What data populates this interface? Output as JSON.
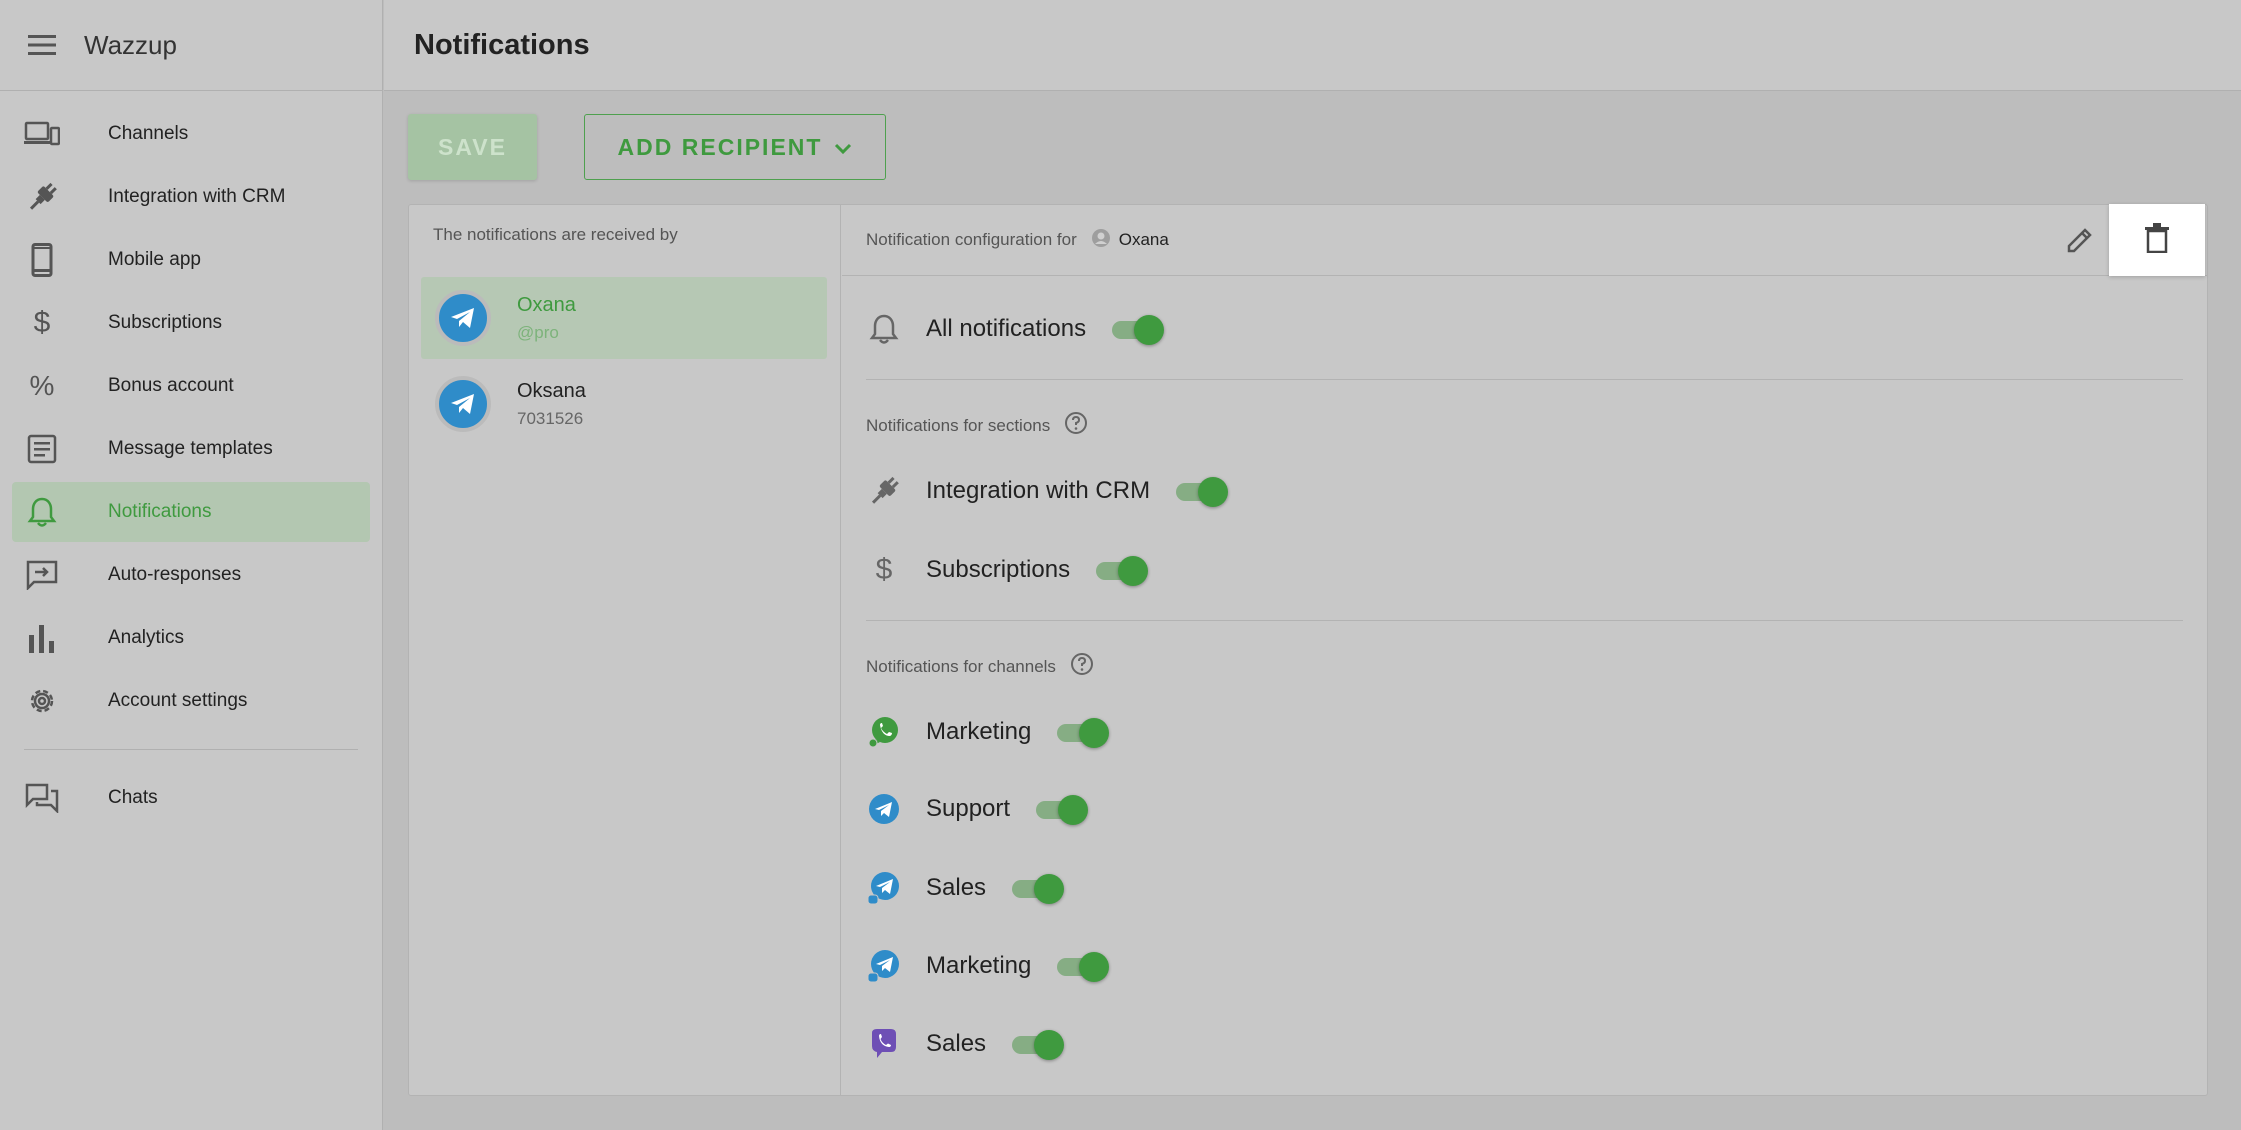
{
  "app": {
    "brand": "Wazzup"
  },
  "header": {
    "title": "Notifications"
  },
  "sidebar": {
    "items": [
      {
        "label": "Channels",
        "icon": "devices-icon"
      },
      {
        "label": "Integration with CRM",
        "icon": "plug-icon"
      },
      {
        "label": "Mobile app",
        "icon": "phone-icon"
      },
      {
        "label": "Subscriptions",
        "icon": "dollar-icon"
      },
      {
        "label": "Bonus account",
        "icon": "percent-icon"
      },
      {
        "label": "Message templates",
        "icon": "document-icon"
      },
      {
        "label": "Notifications",
        "icon": "bell-icon",
        "active": true
      },
      {
        "label": "Auto-responses",
        "icon": "auto-reply-icon"
      },
      {
        "label": "Analytics",
        "icon": "bar-chart-icon"
      },
      {
        "label": "Account settings",
        "icon": "gear-icon"
      }
    ],
    "bottom_items": [
      {
        "label": "Chats",
        "icon": "chats-icon"
      }
    ]
  },
  "toolbar": {
    "save_label": "SAVE",
    "add_recipient_label": "ADD RECIPIENT"
  },
  "recipients": {
    "caption": "The notifications are received by",
    "items": [
      {
        "name": "Oxana",
        "sub": "@pro",
        "active": true
      },
      {
        "name": "Oksana",
        "sub": "7031526",
        "active": false
      }
    ]
  },
  "config": {
    "label": "Notification configuration for",
    "user": "Oxana",
    "all_notifications": {
      "label": "All notifications",
      "enabled": true
    },
    "sections_title": "Notifications for sections",
    "sections": [
      {
        "label": "Integration with CRM",
        "icon": "plug-icon",
        "enabled": true
      },
      {
        "label": "Subscriptions",
        "icon": "dollar-icon",
        "enabled": true
      }
    ],
    "channels_title": "Notifications for channels",
    "channels": [
      {
        "label": "Marketing",
        "icon": "whatsapp-icon",
        "enabled": true
      },
      {
        "label": "Support",
        "icon": "telegram-icon",
        "enabled": true
      },
      {
        "label": "Sales",
        "icon": "telegram-personal-icon",
        "enabled": true
      },
      {
        "label": "Marketing",
        "icon": "telegram-personal-icon",
        "enabled": true
      },
      {
        "label": "Sales",
        "icon": "viber-icon",
        "enabled": true
      }
    ]
  },
  "colors": {
    "accent": "#3f9a3f",
    "telegram": "#2f8cc9",
    "whatsapp": "#3f9a3f",
    "viber": "#6e4fb5"
  }
}
